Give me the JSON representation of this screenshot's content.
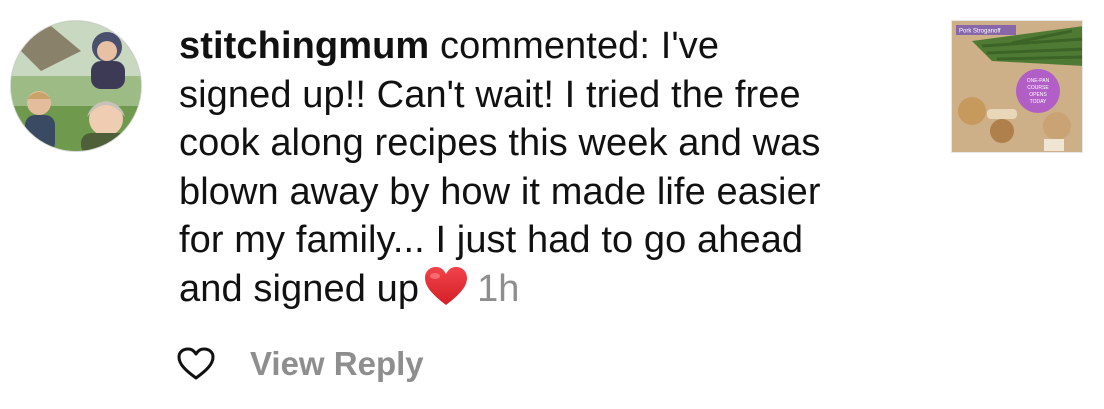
{
  "notification": {
    "username": "stitchingmum",
    "comment_lines": [
      " commented: I've",
      "signed up!! Can't wait!  I tried the free",
      "cook along recipes this week and was",
      "blown away by how it made life easier",
      "for my family... I just had to go ahead",
      "and signed up"
    ],
    "emoji": "red-heart-emoji",
    "time": "1h",
    "avatar_icon": "profile-photo",
    "post_thumbnail": {
      "banner_text": "Pork Stroganoff",
      "badge_lines": [
        "ONE-PAN",
        "COURSE",
        "OPENS",
        "TODAY"
      ],
      "badge_color": "#b15fc7"
    }
  },
  "actions": {
    "like_icon": "heart-outline-icon",
    "view_reply_label": "View Reply"
  },
  "colors": {
    "text": "#111111",
    "muted": "#8e8e8e",
    "heart_red": "#e0262e"
  }
}
